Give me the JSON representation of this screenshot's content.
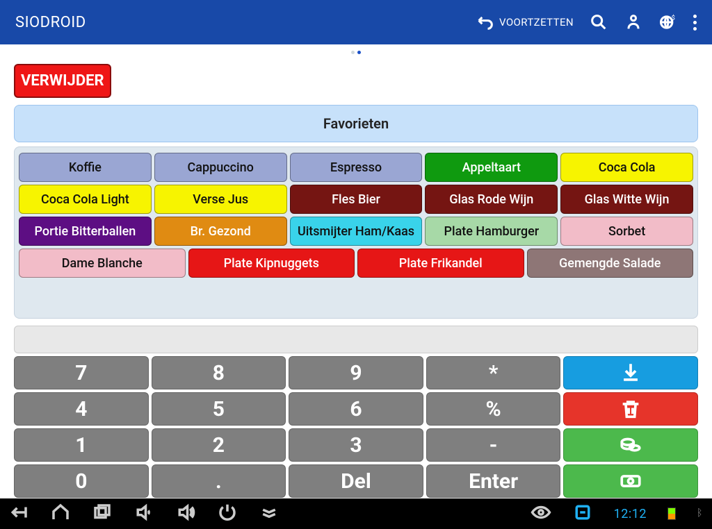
{
  "appbar": {
    "title": "SIODROID",
    "continue_label": "VOORTZETTEN"
  },
  "delete_button": "VERWIJDER",
  "favorites_header": "Favorieten",
  "products": [
    [
      {
        "label": "Koffie",
        "color": "c-lav",
        "key": "koffie"
      },
      {
        "label": "Cappuccino",
        "color": "c-lav",
        "key": "cappuccino"
      },
      {
        "label": "Espresso",
        "color": "c-lav",
        "key": "espresso"
      },
      {
        "label": "Appeltaart",
        "color": "c-green",
        "key": "appeltaart"
      },
      {
        "label": "Coca Cola",
        "color": "c-yellow",
        "key": "coca-cola"
      }
    ],
    [
      {
        "label": "Coca Cola Light",
        "color": "c-yellow",
        "key": "coca-cola-light"
      },
      {
        "label": "Verse Jus",
        "color": "c-yellow",
        "key": "verse-jus"
      },
      {
        "label": "Fles Bier",
        "color": "c-darkred",
        "key": "fles-bier"
      },
      {
        "label": "Glas Rode Wijn",
        "color": "c-darkred",
        "key": "glas-rode-wijn"
      },
      {
        "label": "Glas Witte Wijn",
        "color": "c-darkred",
        "key": "glas-witte-wijn"
      }
    ],
    [
      {
        "label": "Portie Bitterballen",
        "color": "c-purple",
        "key": "portie-bitterballen"
      },
      {
        "label": "Br. Gezond",
        "color": "c-orange",
        "key": "br-gezond"
      },
      {
        "label": "Uitsmijter Ham/Kaas",
        "color": "c-cyan",
        "key": "uitsmijter-ham-kaas"
      },
      {
        "label": "Plate Hamburger",
        "color": "c-ltgrn",
        "key": "plate-hamburger"
      },
      {
        "label": "Sorbet",
        "color": "c-pink",
        "key": "sorbet"
      }
    ],
    [
      {
        "label": "Dame Blanche",
        "color": "c-pink",
        "key": "dame-blanche"
      },
      {
        "label": "Plate Kipnuggets",
        "color": "c-red",
        "key": "plate-kipnuggets"
      },
      {
        "label": "Plate Frikandel",
        "color": "c-red",
        "key": "plate-frikandel"
      },
      {
        "label": "Gemengde Salade",
        "color": "c-taupe",
        "key": "gemengde-salade"
      }
    ]
  ],
  "keypad": {
    "k7": "7",
    "k8": "8",
    "k9": "9",
    "star": "*",
    "k4": "4",
    "k5": "5",
    "k6": "6",
    "pct": "%",
    "k1": "1",
    "k2": "2",
    "k3": "3",
    "minus": "-",
    "k0": "0",
    "dot": ".",
    "del": "Del",
    "enter": "Enter"
  },
  "statusbar": {
    "time": "12:12"
  }
}
